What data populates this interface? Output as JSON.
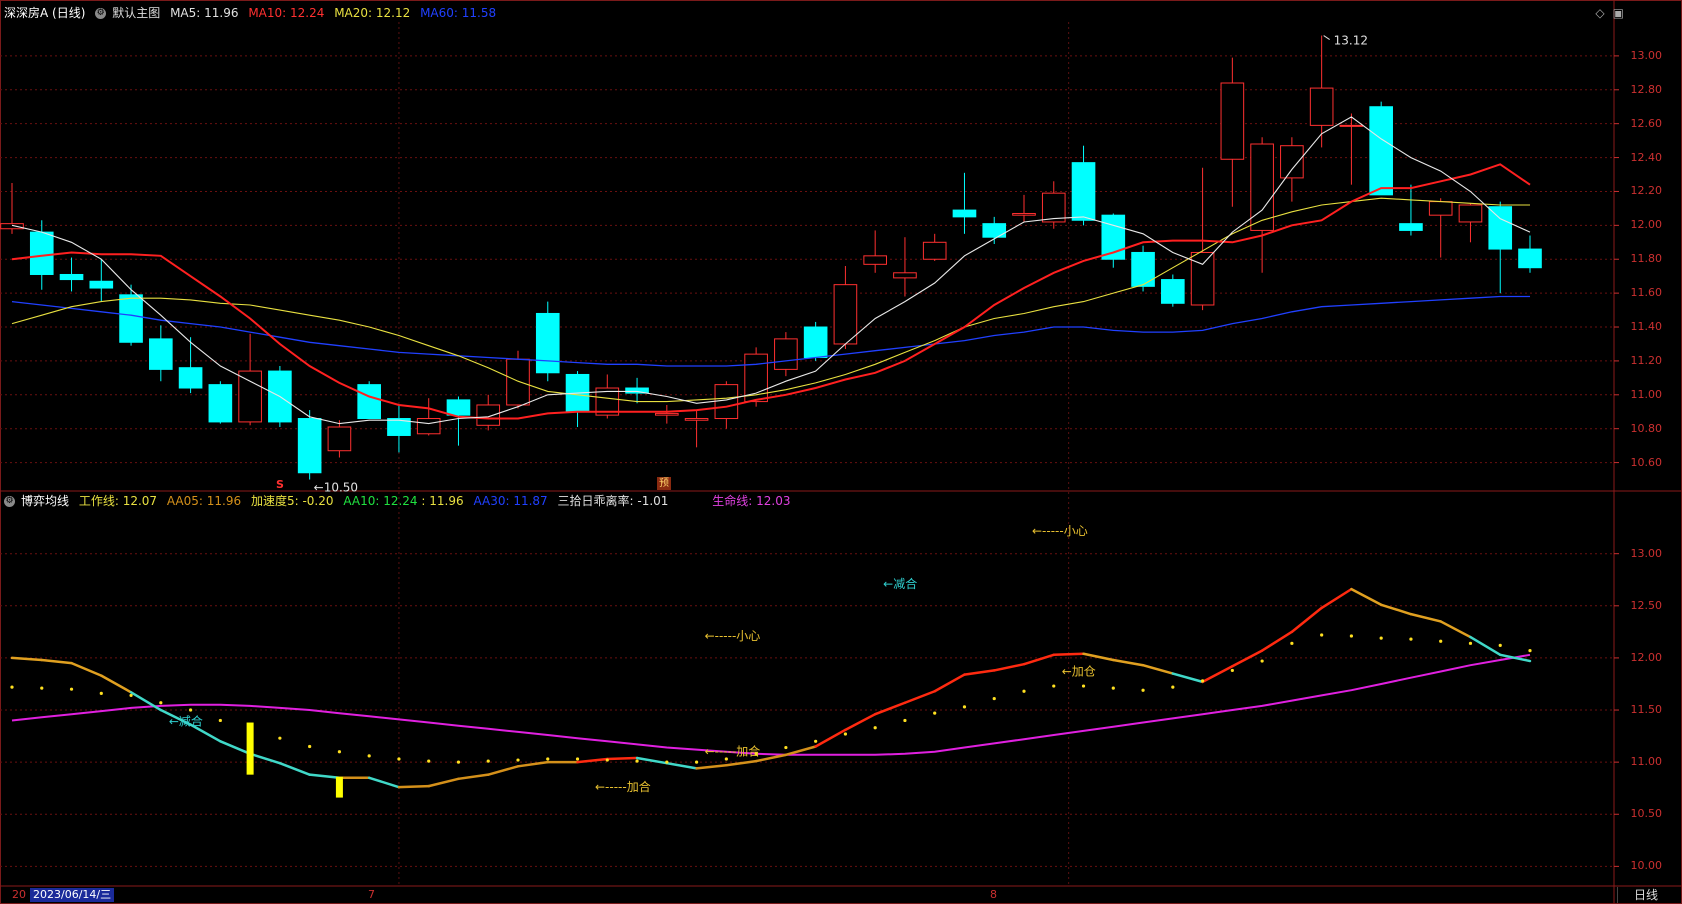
{
  "header": {
    "title": "深深房A (日线)",
    "template": "默认主图",
    "ma": [
      {
        "label": "MA5: 11.96",
        "color": "#e0e0e0"
      },
      {
        "label": "MA10: 12.24",
        "color": "#ff3030"
      },
      {
        "label": "MA20: 12.12",
        "color": "#e8e040"
      },
      {
        "label": "MA60: 11.58",
        "color": "#2040ff"
      }
    ]
  },
  "indicator_header": {
    "name": "博弈均线",
    "items": [
      {
        "label": "工作线: 12.07",
        "color": "#e8e040"
      },
      {
        "label": "AA05: 11.96",
        "color": "#d4901a"
      },
      {
        "label": "加速度5: -0.20",
        "color": "#e8e040"
      },
      {
        "label": "AA10: 12.24",
        "color": "#20e040"
      },
      {
        "label": ": 11.96",
        "color": "#e8e040"
      },
      {
        "label": "AA30: 11.87",
        "color": "#2040ff"
      },
      {
        "label": "三拾日乖离率: -1.01",
        "color": "#e0e0e0"
      },
      {
        "label": "生命线: 12.03",
        "color": "#e040e0"
      }
    ]
  },
  "price_axis_ticks": [
    "13.00",
    "12.80",
    "12.60",
    "12.40",
    "12.20",
    "12.00",
    "11.80",
    "11.60",
    "11.40",
    "11.20",
    "11.00",
    "10.80",
    "10.60"
  ],
  "indicator_axis_ticks": [
    "13.00",
    "12.50",
    "12.00",
    "11.50",
    "11.00",
    "10.50",
    "10.00"
  ],
  "footer": {
    "date_left": "20",
    "date": "2023/06/14/三",
    "month_marks": [
      {
        "label": "7"
      },
      {
        "label": "8"
      }
    ],
    "period": "日线"
  },
  "annotations": {
    "high_label": "13.12",
    "low_label": "10.50",
    "flag_s": "S",
    "flag_pre": "预"
  },
  "icons": [
    "diamond-icon",
    "window-icon"
  ],
  "chart_data": [
    {
      "type": "candlestick",
      "title": "深深房A (日线)",
      "ylim": [
        10.45,
        13.2
      ],
      "candles": [
        {
          "o": 11.98,
          "h": 12.25,
          "l": 11.95,
          "c": 12.01
        },
        {
          "o": 11.96,
          "h": 12.03,
          "l": 11.62,
          "c": 11.71
        },
        {
          "o": 11.71,
          "h": 11.81,
          "l": 11.61,
          "c": 11.68
        },
        {
          "o": 11.67,
          "h": 11.8,
          "l": 11.55,
          "c": 11.63
        },
        {
          "o": 11.59,
          "h": 11.65,
          "l": 11.29,
          "c": 11.31
        },
        {
          "o": 11.33,
          "h": 11.41,
          "l": 11.08,
          "c": 11.15
        },
        {
          "o": 11.16,
          "h": 11.34,
          "l": 11.01,
          "c": 11.04
        },
        {
          "o": 11.06,
          "h": 11.08,
          "l": 10.83,
          "c": 10.84
        },
        {
          "o": 10.84,
          "h": 11.36,
          "l": 10.82,
          "c": 11.14
        },
        {
          "o": 11.14,
          "h": 11.17,
          "l": 10.81,
          "c": 10.84
        },
        {
          "o": 10.86,
          "h": 10.91,
          "l": 10.5,
          "c": 10.54
        },
        {
          "o": 10.67,
          "h": 10.85,
          "l": 10.63,
          "c": 10.81
        },
        {
          "o": 11.06,
          "h": 11.08,
          "l": 10.86,
          "c": 10.86
        },
        {
          "o": 10.86,
          "h": 10.94,
          "l": 10.66,
          "c": 10.76
        },
        {
          "o": 10.77,
          "h": 10.98,
          "l": 10.76,
          "c": 10.86
        },
        {
          "o": 10.97,
          "h": 10.99,
          "l": 10.7,
          "c": 10.88
        },
        {
          "o": 10.82,
          "h": 11.0,
          "l": 10.79,
          "c": 10.94
        },
        {
          "o": 10.94,
          "h": 11.26,
          "l": 10.92,
          "c": 11.21
        },
        {
          "o": 11.48,
          "h": 11.55,
          "l": 11.08,
          "c": 11.13
        },
        {
          "o": 11.12,
          "h": 11.14,
          "l": 10.81,
          "c": 10.9
        },
        {
          "o": 10.88,
          "h": 11.12,
          "l": 10.86,
          "c": 11.04
        },
        {
          "o": 11.04,
          "h": 11.1,
          "l": 10.95,
          "c": 11.01
        },
        {
          "o": 10.88,
          "h": 10.94,
          "l": 10.83,
          "c": 10.89
        },
        {
          "o": 10.85,
          "h": 10.91,
          "l": 10.69,
          "c": 10.86
        },
        {
          "o": 10.86,
          "h": 11.08,
          "l": 10.8,
          "c": 11.06
        },
        {
          "o": 10.96,
          "h": 11.28,
          "l": 10.93,
          "c": 11.24
        },
        {
          "o": 11.15,
          "h": 11.37,
          "l": 11.11,
          "c": 11.33
        },
        {
          "o": 11.4,
          "h": 11.43,
          "l": 11.2,
          "c": 11.22
        },
        {
          "o": 11.3,
          "h": 11.76,
          "l": 11.27,
          "c": 11.65
        },
        {
          "o": 11.77,
          "h": 11.97,
          "l": 11.72,
          "c": 11.82
        },
        {
          "o": 11.69,
          "h": 11.93,
          "l": 11.58,
          "c": 11.72
        },
        {
          "o": 11.8,
          "h": 11.95,
          "l": 11.79,
          "c": 11.9
        },
        {
          "o": 12.09,
          "h": 12.31,
          "l": 11.95,
          "c": 12.05
        },
        {
          "o": 12.01,
          "h": 12.05,
          "l": 11.89,
          "c": 11.93
        },
        {
          "o": 12.06,
          "h": 12.18,
          "l": 12.02,
          "c": 12.07
        },
        {
          "o": 12.02,
          "h": 12.26,
          "l": 11.98,
          "c": 12.19
        },
        {
          "o": 12.37,
          "h": 12.47,
          "l": 12.0,
          "c": 12.03
        },
        {
          "o": 12.06,
          "h": 12.07,
          "l": 11.75,
          "c": 11.8
        },
        {
          "o": 11.84,
          "h": 11.88,
          "l": 11.61,
          "c": 11.64
        },
        {
          "o": 11.68,
          "h": 11.71,
          "l": 11.52,
          "c": 11.54
        },
        {
          "o": 11.53,
          "h": 12.34,
          "l": 11.5,
          "c": 11.84
        },
        {
          "o": 12.39,
          "h": 12.99,
          "l": 12.11,
          "c": 12.84
        },
        {
          "o": 11.97,
          "h": 12.52,
          "l": 11.72,
          "c": 12.48
        },
        {
          "o": 12.28,
          "h": 12.52,
          "l": 12.14,
          "c": 12.47
        },
        {
          "o": 12.59,
          "h": 13.12,
          "l": 12.46,
          "c": 12.81
        },
        {
          "o": 12.59,
          "h": 12.66,
          "l": 12.24,
          "c": 12.59
        },
        {
          "o": 12.7,
          "h": 12.73,
          "l": 12.18,
          "c": 12.18
        },
        {
          "o": 12.01,
          "h": 12.24,
          "l": 11.94,
          "c": 11.97
        },
        {
          "o": 12.06,
          "h": 12.16,
          "l": 11.81,
          "c": 12.14
        },
        {
          "o": 12.02,
          "h": 12.13,
          "l": 11.9,
          "c": 12.12
        },
        {
          "o": 12.11,
          "h": 12.14,
          "l": 11.6,
          "c": 11.86
        },
        {
          "o": 11.86,
          "h": 11.94,
          "l": 11.72,
          "c": 11.75
        }
      ],
      "ma5": [
        12.0,
        11.96,
        11.9,
        11.8,
        11.62,
        11.47,
        11.31,
        11.17,
        11.08,
        10.99,
        10.87,
        10.83,
        10.85,
        10.85,
        10.83,
        10.86,
        10.87,
        10.93,
        11.0,
        11.01,
        11.02,
        11.02,
        10.99,
        10.95,
        10.97,
        11.01,
        11.08,
        11.14,
        11.3,
        11.45,
        11.55,
        11.66,
        11.82,
        11.92,
        12.02,
        12.04,
        12.05,
        12.0,
        11.95,
        11.84,
        11.77,
        11.96,
        12.09,
        12.33,
        12.54,
        12.64,
        12.51,
        12.4,
        12.32,
        12.2,
        12.04,
        11.96
      ],
      "ma10": [
        11.8,
        11.82,
        11.84,
        11.83,
        11.83,
        11.82,
        11.7,
        11.58,
        11.45,
        11.3,
        11.17,
        11.07,
        10.99,
        10.94,
        10.92,
        10.87,
        10.86,
        10.86,
        10.89,
        10.9,
        10.9,
        10.9,
        10.9,
        10.91,
        10.93,
        10.97,
        11.0,
        11.04,
        11.09,
        11.13,
        11.2,
        11.3,
        11.4,
        11.53,
        11.63,
        11.72,
        11.79,
        11.84,
        11.9,
        11.91,
        11.91,
        11.9,
        11.94,
        12.0,
        12.03,
        12.14,
        12.22,
        12.22,
        12.26,
        12.3,
        12.36,
        12.24
      ],
      "ma20": [
        11.42,
        11.47,
        11.52,
        11.55,
        11.57,
        11.57,
        11.56,
        11.54,
        11.53,
        11.5,
        11.47,
        11.44,
        11.4,
        11.35,
        11.29,
        11.23,
        11.16,
        11.08,
        11.02,
        11.0,
        10.98,
        10.96,
        10.96,
        10.97,
        10.98,
        11.0,
        11.03,
        11.07,
        11.12,
        11.18,
        11.25,
        11.32,
        11.4,
        11.45,
        11.48,
        11.52,
        11.55,
        11.6,
        11.65,
        11.75,
        11.85,
        11.95,
        12.03,
        12.08,
        12.12,
        12.14,
        12.16,
        12.15,
        12.14,
        12.13,
        12.12,
        12.12
      ],
      "ma60": [
        11.55,
        11.53,
        11.51,
        11.49,
        11.47,
        11.44,
        11.42,
        11.4,
        11.37,
        11.34,
        11.31,
        11.29,
        11.27,
        11.25,
        11.24,
        11.23,
        11.22,
        11.21,
        11.2,
        11.19,
        11.18,
        11.18,
        11.17,
        11.17,
        11.17,
        11.18,
        11.2,
        11.22,
        11.24,
        11.26,
        11.28,
        11.3,
        11.32,
        11.35,
        11.37,
        11.4,
        11.4,
        11.38,
        11.37,
        11.37,
        11.38,
        11.42,
        11.45,
        11.49,
        11.52,
        11.53,
        11.54,
        11.55,
        11.56,
        11.57,
        11.58,
        11.58
      ]
    },
    {
      "type": "line",
      "title": "博弈均线",
      "ylim": [
        9.85,
        13.4
      ],
      "work_line": [
        12.0,
        11.98,
        11.95,
        11.83,
        11.67,
        11.5,
        11.36,
        11.2,
        11.08,
        10.99,
        10.88,
        10.85,
        10.85,
        10.76,
        10.77,
        10.84,
        10.88,
        10.96,
        11.0,
        11.0,
        11.03,
        11.04,
        10.99,
        10.94,
        10.97,
        11.01,
        11.07,
        11.15,
        11.31,
        11.46,
        11.57,
        11.68,
        11.84,
        11.88,
        11.94,
        12.03,
        12.04,
        11.98,
        11.93,
        11.85,
        11.77,
        11.92,
        12.07,
        12.25,
        12.48,
        12.66,
        12.51,
        12.42,
        12.35,
        12.2,
        12.03,
        11.97
      ],
      "dots": [
        11.72,
        11.71,
        11.7,
        11.66,
        11.64,
        11.57,
        11.5,
        11.4,
        11.33,
        11.23,
        11.15,
        11.1,
        11.06,
        11.03,
        11.01,
        11.0,
        11.01,
        11.02,
        11.03,
        11.03,
        11.02,
        11.01,
        11.0,
        11.0,
        11.03,
        11.08,
        11.14,
        11.2,
        11.27,
        11.33,
        11.4,
        11.47,
        11.53,
        11.61,
        11.68,
        11.73,
        11.73,
        11.71,
        11.69,
        11.72,
        11.78,
        11.88,
        11.97,
        12.14,
        12.22,
        12.21,
        12.19,
        12.18,
        12.16,
        12.14,
        12.12,
        12.07
      ],
      "life_line": [
        11.4,
        11.43,
        11.46,
        11.49,
        11.52,
        11.54,
        11.55,
        11.55,
        11.54,
        11.52,
        11.5,
        11.47,
        11.44,
        11.41,
        11.38,
        11.35,
        11.32,
        11.29,
        11.26,
        11.23,
        11.2,
        11.17,
        11.14,
        11.12,
        11.1,
        11.08,
        11.07,
        11.07,
        11.07,
        11.07,
        11.08,
        11.1,
        11.14,
        11.18,
        11.22,
        11.26,
        11.3,
        11.34,
        11.38,
        11.42,
        11.46,
        11.5,
        11.54,
        11.59,
        11.64,
        11.69,
        11.75,
        11.81,
        11.87,
        11.93,
        11.98,
        12.03
      ],
      "yellow_bars": [
        {
          "i": 8,
          "from": 11.38,
          "to": 10.88
        },
        {
          "i": 11,
          "from": 10.86,
          "to": 10.66
        }
      ],
      "signals": [
        {
          "i": 5,
          "value": 11.39,
          "text": "←减合",
          "color": "#30d0d0"
        },
        {
          "i": -1,
          "value": 10.76,
          "text": "←-----加合",
          "color": "#e8c030"
        },
        {
          "i": 23,
          "value": 11.1,
          "text": "←-----加合",
          "color": "#e8c030"
        },
        {
          "i": 23,
          "value": 12.21,
          "text": "←-----小心",
          "color": "#e8c030"
        },
        {
          "i": 29,
          "value": 12.71,
          "text": "←减合",
          "color": "#30d0d0"
        },
        {
          "i": 34,
          "value": 13.22,
          "text": "←-----小心",
          "color": "#e8c030"
        },
        {
          "i": 35,
          "value": 11.87,
          "text": "←加仓",
          "color": "#e8c030"
        }
      ]
    }
  ]
}
